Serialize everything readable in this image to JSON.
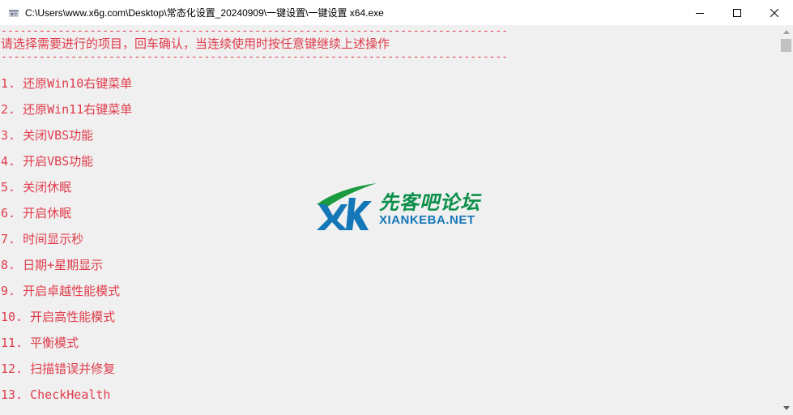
{
  "window": {
    "title": "C:\\Users\\www.x6g.com\\Desktop\\常态化设置_20240909\\一键设置\\一键设置 x64.exe"
  },
  "console": {
    "dash_line": "--------------------------------------------------------------------------------",
    "header": "请选择需要进行的项目，回车确认，当连续使用时按任意键继续上述操作",
    "items": [
      "1. 还原Win10右键菜单",
      "2. 还原Win11右键菜单",
      "3. 关闭VBS功能",
      "4. 开启VBS功能",
      "5. 关闭休眠",
      "6. 开启休眠",
      "7. 时间显示秒",
      "8. 日期+星期显示",
      "9. 开启卓越性能模式",
      "10. 开启高性能模式",
      "11. 平衡模式",
      "12. 扫描错误并修复",
      "13. CheckHealth"
    ],
    "text_color": "#e03c4b",
    "background": "#f0f0f0"
  },
  "watermark": {
    "logo_text": "XK",
    "title": "先客吧论坛",
    "subtitle": "XIANKEBA.NET"
  },
  "icons": {
    "app": "console-app-icon",
    "minimize": "minimize-icon",
    "maximize": "maximize-icon",
    "close": "close-icon",
    "scroll_up": "scroll-up-arrow-icon",
    "scroll_down": "scroll-down-arrow-icon"
  }
}
